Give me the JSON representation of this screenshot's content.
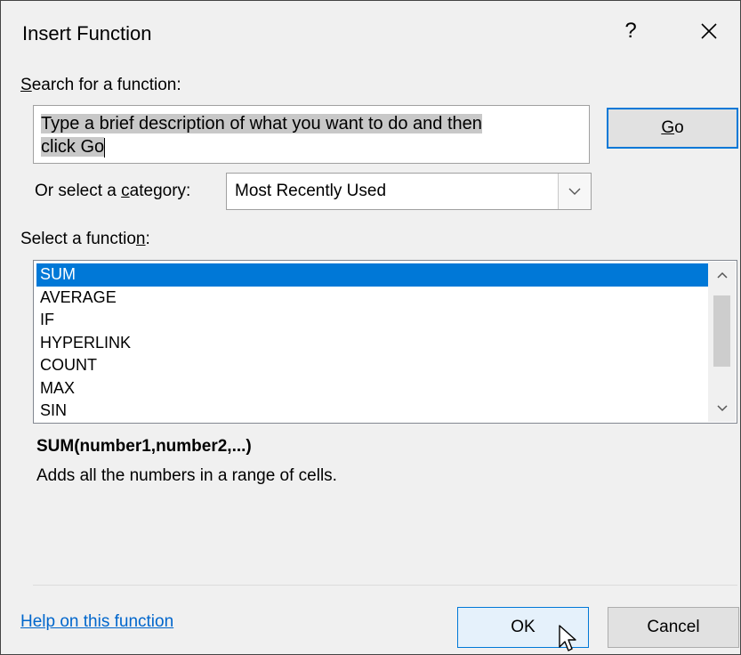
{
  "dialog": {
    "title": "Insert Function",
    "help_glyph": "?",
    "close_glyph": "X"
  },
  "search": {
    "label_pre": "",
    "label_accel": "S",
    "label_post": "earch for a function:",
    "value_line1": "Type a brief description of what you want to do and then",
    "value_line2": "click Go",
    "go_accel": "G",
    "go_post": "o"
  },
  "category": {
    "label_pre": "Or select a ",
    "label_accel": "c",
    "label_post": "ategory:",
    "selected": "Most Recently Used"
  },
  "functions": {
    "label_pre": "Select a functio",
    "label_accel": "n",
    "label_post": ":",
    "items": [
      "SUM",
      "AVERAGE",
      "IF",
      "HYPERLINK",
      "COUNT",
      "MAX",
      "SIN"
    ],
    "selected_index": 0
  },
  "details": {
    "signature": "SUM(number1,number2,...)",
    "description": "Adds all the numbers in a range of cells."
  },
  "footer": {
    "help_link": "Help on this function",
    "ok_label": "OK",
    "cancel_label": "Cancel"
  },
  "colors": {
    "accent": "#0078d7",
    "link": "#0066cc",
    "dialog_bg": "#f0f0f0"
  },
  "icons": {
    "category_dropdown": "chevron-down-icon",
    "scroll_up": "chevron-up-icon",
    "scroll_down": "chevron-down-icon",
    "cursor": "mouse-pointer-icon"
  }
}
